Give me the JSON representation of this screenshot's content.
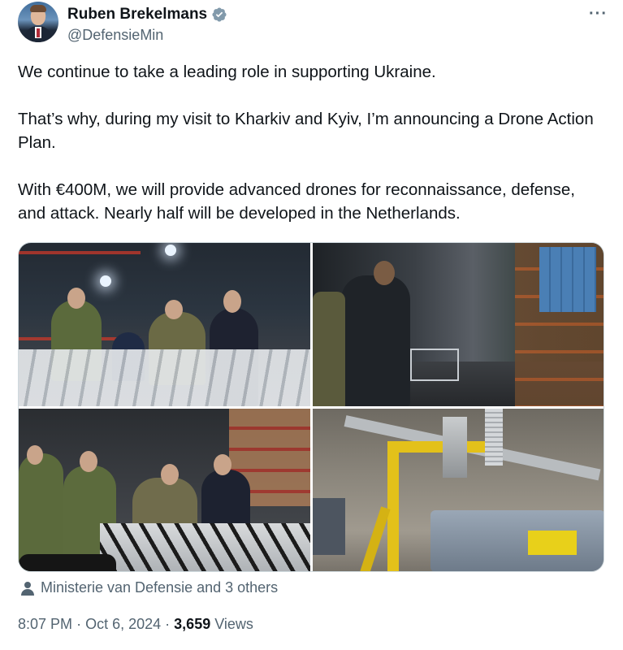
{
  "author": {
    "display_name": "Ruben Brekelmans",
    "handle": "@DefensieMin",
    "verified_color": "#829aab",
    "more_icon": "more-horizontal-icon"
  },
  "tweet": {
    "paragraphs": [
      "We continue to take a leading role in supporting Ukraine.",
      "That’s why, during my visit to Kharkiv and Kyiv, I’m announcing a Drone Action Plan.",
      "With €400M, we will provide advanced drones for reconnaissance, defense, and attack. Nearly half will be developed in the Netherlands."
    ]
  },
  "media": {
    "count": 4,
    "photos": [
      {
        "label": "photo-officials-inspecting-drone-panels"
      },
      {
        "label": "photo-warehouse-with-person-walking"
      },
      {
        "label": "photo-soldiers-at-drone-frame"
      },
      {
        "label": "photo-yellow-crane-workshop"
      }
    ]
  },
  "tagged": {
    "text": "Ministerie van Defensie and 3 others"
  },
  "meta": {
    "time": "8:07 PM",
    "separator": "·",
    "date": "Oct 6, 2024",
    "views_count": "3,659",
    "views_label": "Views"
  },
  "colors": {
    "text_primary": "#0f1419",
    "text_secondary": "#536471",
    "border": "#cfd9de"
  }
}
